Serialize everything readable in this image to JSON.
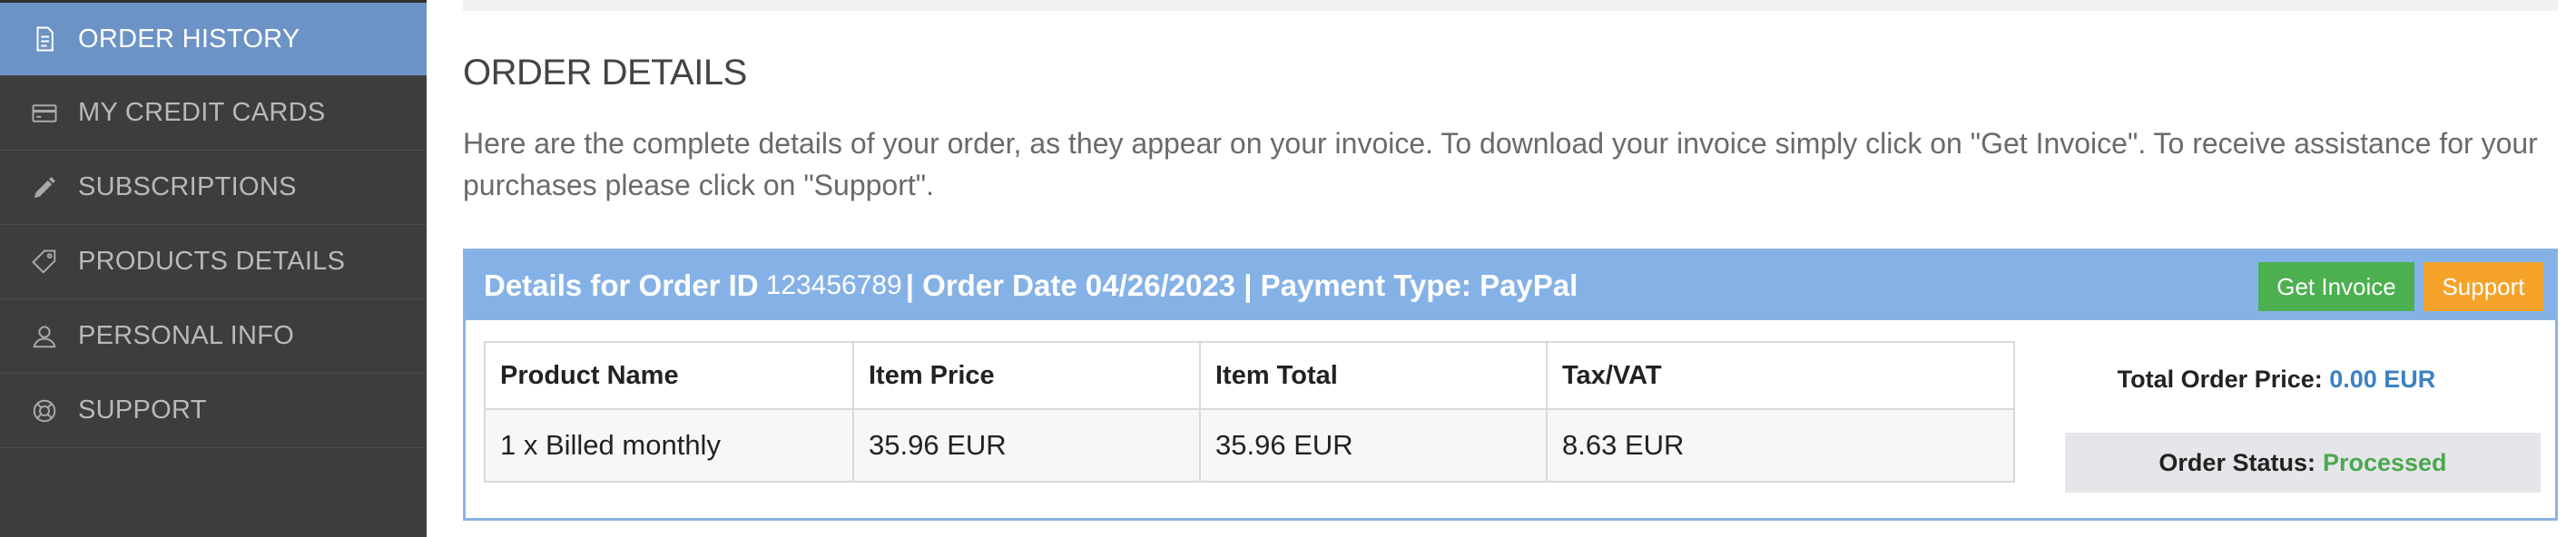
{
  "sidebar": {
    "items": [
      {
        "label": "ORDER HISTORY",
        "icon": "document-icon",
        "active": true
      },
      {
        "label": "MY CREDIT CARDS",
        "icon": "credit-card-icon",
        "active": false
      },
      {
        "label": "SUBSCRIPTIONS",
        "icon": "pencil-icon",
        "active": false
      },
      {
        "label": "PRODUCTS DETAILS",
        "icon": "tag-icon",
        "active": false
      },
      {
        "label": "PERSONAL INFO",
        "icon": "user-icon",
        "active": false
      },
      {
        "label": "SUPPORT",
        "icon": "lifebuoy-icon",
        "active": false
      }
    ]
  },
  "main": {
    "title": "ORDER DETAILS",
    "intro": "Here are the complete details of your order, as they appear on your invoice. To download your invoice simply click on \"Get Invoice\". To receive assistance for your purchases please click on \"Support\"."
  },
  "order": {
    "header_prefix": "Details for Order ID",
    "order_id": "123456789",
    "header_date": "| Order Date 04/26/2023 | Payment Type: PayPal",
    "get_invoice_label": "Get Invoice",
    "support_label": "Support",
    "columns": [
      "Product Name",
      "Item Price",
      "Item Total",
      "Tax/VAT"
    ],
    "rows": [
      [
        "1 x Billed monthly",
        "35.96 EUR",
        "35.96 EUR",
        "8.63 EUR"
      ]
    ],
    "total_label": "Total Order Price:",
    "total_value": "0.00 EUR",
    "status_label": "Order Status:",
    "status_value": "Processed"
  },
  "colors": {
    "sidebar_bg": "#3d3d3d",
    "active_item": "#6c93c5",
    "header_bg": "#85b2e6",
    "invoice_btn": "#4caf50",
    "support_btn": "#f5a32b",
    "status_ok": "#4aa84e",
    "price_blue": "#3b82c4"
  }
}
